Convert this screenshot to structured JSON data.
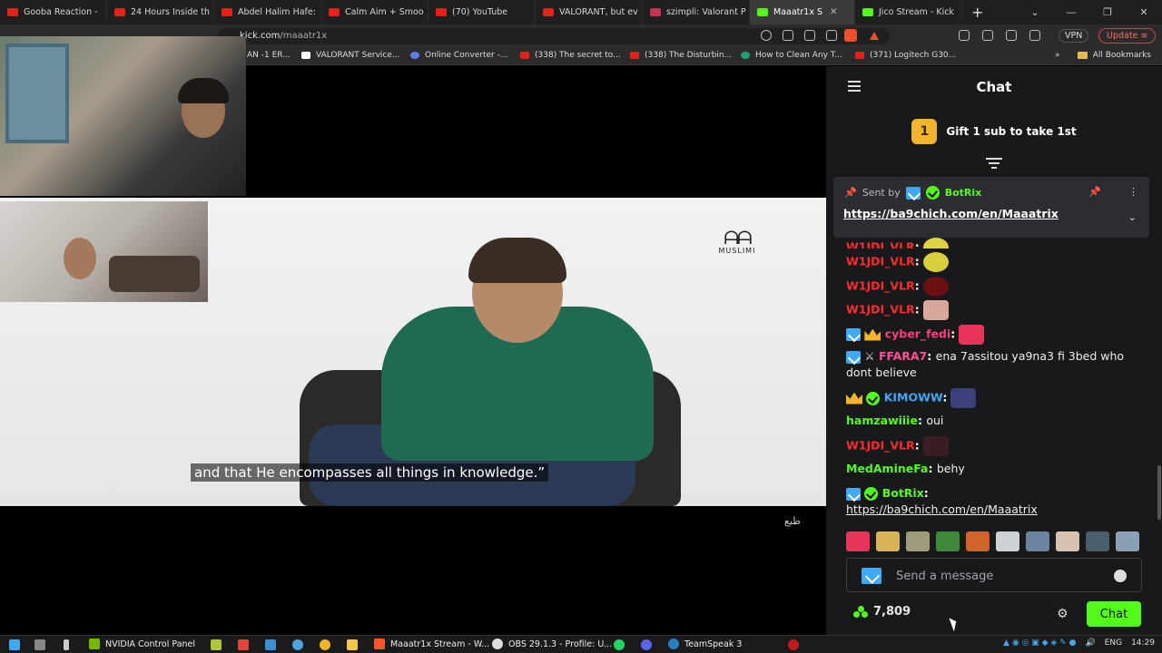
{
  "browser": {
    "tabs": [
      {
        "label": "Gooba Reaction -",
        "fav": "#e62117"
      },
      {
        "label": "24 Hours Inside th",
        "fav": "#e62117"
      },
      {
        "label": "Abdel Halim Hafe:",
        "fav": "#e62117"
      },
      {
        "label": "Calm Aim + Smoo",
        "fav": "#e62117"
      },
      {
        "label": "(70) YouTube",
        "fav": "#e62117"
      },
      {
        "label": "VALORANT, but ev",
        "fav": "#e62117"
      },
      {
        "label": "szimpli: Valorant P",
        "fav": "#c43350"
      },
      {
        "label": "Maaatr1x S",
        "fav": "#53fc18",
        "active": true
      },
      {
        "label": "Jico Stream - Kick",
        "fav": "#53fc18"
      }
    ],
    "url_host": "kick.com",
    "url_path": "/maaatr1x",
    "vpn_label": "VPN",
    "update_label": "Update",
    "bookmarks": [
      {
        "label": "AN -1 ER...",
        "color": "#e62117"
      },
      {
        "label": "VALORANT Service...",
        "color": "#ffffff"
      },
      {
        "label": "Online Converter -...",
        "color": "#5a7de8"
      },
      {
        "label": "(338) The secret to...",
        "color": "#e62117"
      },
      {
        "label": "(338) The Disturbin...",
        "color": "#e62117"
      },
      {
        "label": "How to Clean Any T...",
        "color": "#1aa37a"
      },
      {
        "label": "(371) Logitech G30...",
        "color": "#e62117"
      }
    ],
    "all_bookmarks_label": "All Bookmarks"
  },
  "video": {
    "subtitle": "and that He encompasses all things in knowledge.”",
    "logo_text": "MUSLIMI",
    "logo_mark": "ᗩᗩ",
    "watermark": "طبع"
  },
  "chat": {
    "title": "Chat",
    "gift_num": "1",
    "gift_text": "Gift 1 sub to take 1st",
    "pinned": {
      "sent_by": "Sent by",
      "user": "BotRix",
      "url": "https://ba9chich.com/en/Maaatrix"
    },
    "messages": [
      {
        "user": "W1JDI_VLR",
        "color": "#ff2a2a",
        "text": "",
        "emote": "#e0d245"
      },
      {
        "user": "W1JDI_VLR",
        "color": "#ff2a2a",
        "text": "",
        "emote": "#d8cf3a"
      },
      {
        "user": "W1JDI_VLR",
        "color": "#ff2a2a",
        "text": "",
        "emote": "#6b0f12"
      },
      {
        "user": "W1JDI_VLR",
        "color": "#ff2a2a",
        "text": "",
        "emote": "#d8a79a"
      },
      {
        "user": "cyber_fedi",
        "color": "#ff3b7f",
        "text": "",
        "emote": "#e8345a"
      },
      {
        "user": "FFARA7",
        "color": "#ff4f9a",
        "text": "ena 7assitou ya9na3 fi 3bed who dont believe"
      },
      {
        "user": "KIMOWW",
        "color": "#3fa9f5",
        "text": "",
        "emote": "#3b3f7a"
      },
      {
        "user": "hamzawiiie",
        "color": "#53fc18",
        "text": "oui"
      },
      {
        "user": "W1JDI_VLR",
        "color": "#ff2a2a",
        "text": "",
        "emote": "#3a1f22"
      },
      {
        "user": "MedAmineFa",
        "color": "#53fc18",
        "text": "behy"
      },
      {
        "user": "BotRix",
        "color": "#53fc18",
        "text": "https://ba9chich.com/en/Maaatrix"
      }
    ],
    "emotes": [
      "#e8345a",
      "#d7b356",
      "#9d9b7a",
      "#3e8a3c",
      "#d0622a",
      "#cfd2d4",
      "#6a84a0",
      "#d7c1b0",
      "#4a5d6a",
      "#8aa0b5"
    ],
    "input_placeholder": "Send a message",
    "points": "7,809",
    "send_label": "Chat"
  },
  "taskbar": {
    "items": [
      {
        "label": "NVIDIA Control Panel",
        "color": "#76b900"
      },
      {
        "label": "Maaatr1x Stream - W...",
        "color": "#fb542b"
      },
      {
        "label": "OBS 29.1.3 - Profile: U...",
        "color": "#dddddd"
      },
      {
        "label": "TeamSpeak 3",
        "color": "#2580c3"
      }
    ],
    "lang": "ENG",
    "time": "14:29"
  }
}
